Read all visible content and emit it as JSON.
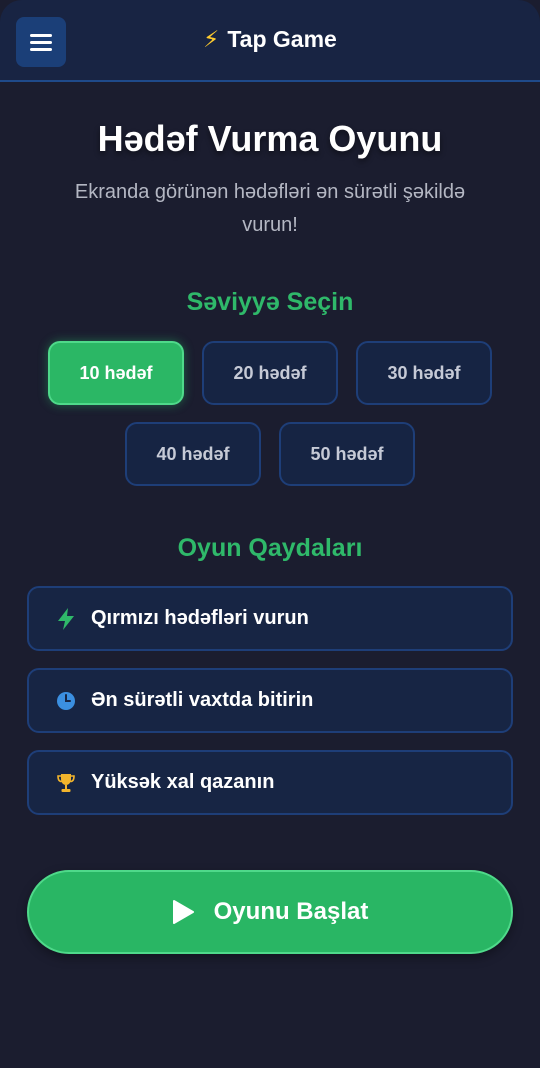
{
  "header": {
    "brand_icon": "⚡",
    "brand_title": "Tap Game"
  },
  "main": {
    "title": "Hədəf Vurma Oyunu",
    "subtitle": "Ekranda görünən hədəfləri ən sürətli şəkildə vurun!"
  },
  "levels": {
    "heading": "Səviyyə Seçin",
    "items": [
      {
        "label": "10 hədəf",
        "selected": true
      },
      {
        "label": "20 hədəf",
        "selected": false
      },
      {
        "label": "30 hədəf",
        "selected": false
      },
      {
        "label": "40 hədəf",
        "selected": false
      },
      {
        "label": "50 hədəf",
        "selected": false
      }
    ]
  },
  "rules": {
    "heading": "Oyun Qaydaları",
    "items": [
      {
        "icon": "bolt-icon",
        "text": "Qırmızı hədəfləri vurun"
      },
      {
        "icon": "clock-icon",
        "text": "Ən sürətli vaxtda bitirin"
      },
      {
        "icon": "trophy-icon",
        "text": "Yüksək xal qazanın"
      }
    ]
  },
  "start": {
    "label": "Oyunu Başlat"
  },
  "colors": {
    "accent_green": "#2bb765",
    "header_bg": "#182443",
    "page_bg": "#1b1d2f",
    "bolt_yellow": "#ffcc2e"
  }
}
